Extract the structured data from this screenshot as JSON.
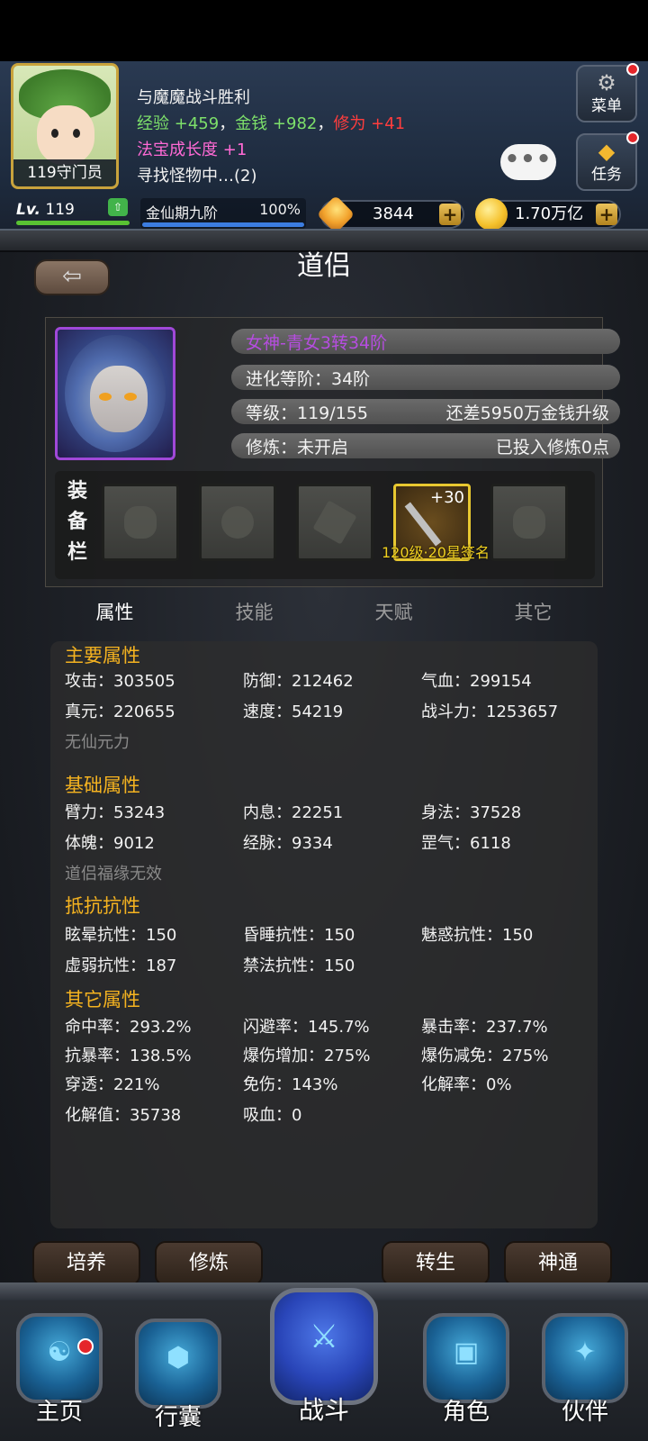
{
  "hud": {
    "player_title": "119守门员",
    "log": {
      "line1": "与魔魔战斗胜利",
      "exp_label": "经验",
      "exp_value": "+459",
      "sep1": "，",
      "money_label": "金钱",
      "money_value": "+982",
      "sep2": "，",
      "cult_label": "修为",
      "cult_value": "+41",
      "treasure_label": "法宝成长度",
      "treasure_value": "+1",
      "line4": "寻找怪物中…(2)"
    },
    "chat_label": "•••",
    "menu_label": "菜单",
    "task_label": "任务",
    "level": "119",
    "level_prefix": "Lv.",
    "realm_name": "金仙期九阶",
    "realm_percent": "100%",
    "realm_progress": 1.0,
    "gems": "3844",
    "gold": "1.70万亿",
    "plus": "+"
  },
  "page": {
    "title": "道侣",
    "back_icon": "arrow-left-icon"
  },
  "pet": {
    "name": "女神-青女3转34阶",
    "evolution": "进化等阶：34阶",
    "level": "等级：119/155",
    "level_hint": "还差5950万金钱升级",
    "train": "修炼：未开启",
    "train_hint": "已投入修炼0点",
    "equip_label_1": "装",
    "equip_label_2": "备",
    "equip_label_3": "栏",
    "weapon_plus": "+30",
    "weapon_caption": "120级·20星签名"
  },
  "tabs": [
    "属性",
    "技能",
    "天赋",
    "其它"
  ],
  "attributes": {
    "main_title": "主要属性",
    "main": [
      "攻击：303505",
      "防御：212462",
      "气血：299154",
      "真元：220655",
      "速度：54219",
      "战斗力：1253657"
    ],
    "main_note": "无仙元力",
    "base_title": "基础属性",
    "base": [
      "臂力：53243",
      "内息：22251",
      "身法：37528",
      "体魄：9012",
      "经脉：9334",
      "罡气：6118"
    ],
    "base_note": "道侣福缘无效",
    "resist_title": "抵抗抗性",
    "resist": [
      "眩晕抗性：150",
      "昏睡抗性：150",
      "魅惑抗性：150",
      "虚弱抗性：187",
      "禁法抗性：150"
    ],
    "other_title": "其它属性",
    "other": [
      "命中率：293.2%",
      "闪避率：145.7%",
      "暴击率：237.7%",
      "抗暴率：138.5%",
      "爆伤增加：275%",
      "爆伤减免：275%",
      "穿透：221%",
      "免伤：143%",
      "化解率：0%",
      "化解值：35738",
      "吸血：0"
    ]
  },
  "actions": [
    "培养",
    "修炼",
    "转生",
    "神通"
  ],
  "nav": [
    "主页",
    "行囊",
    "战斗",
    "角色",
    "伙伴"
  ],
  "colors": {
    "accent_gold": "#f5b320",
    "pet_name_purple": "#b64de0",
    "gain_green": "#7de06a",
    "gain_red": "#ff3d3d"
  }
}
